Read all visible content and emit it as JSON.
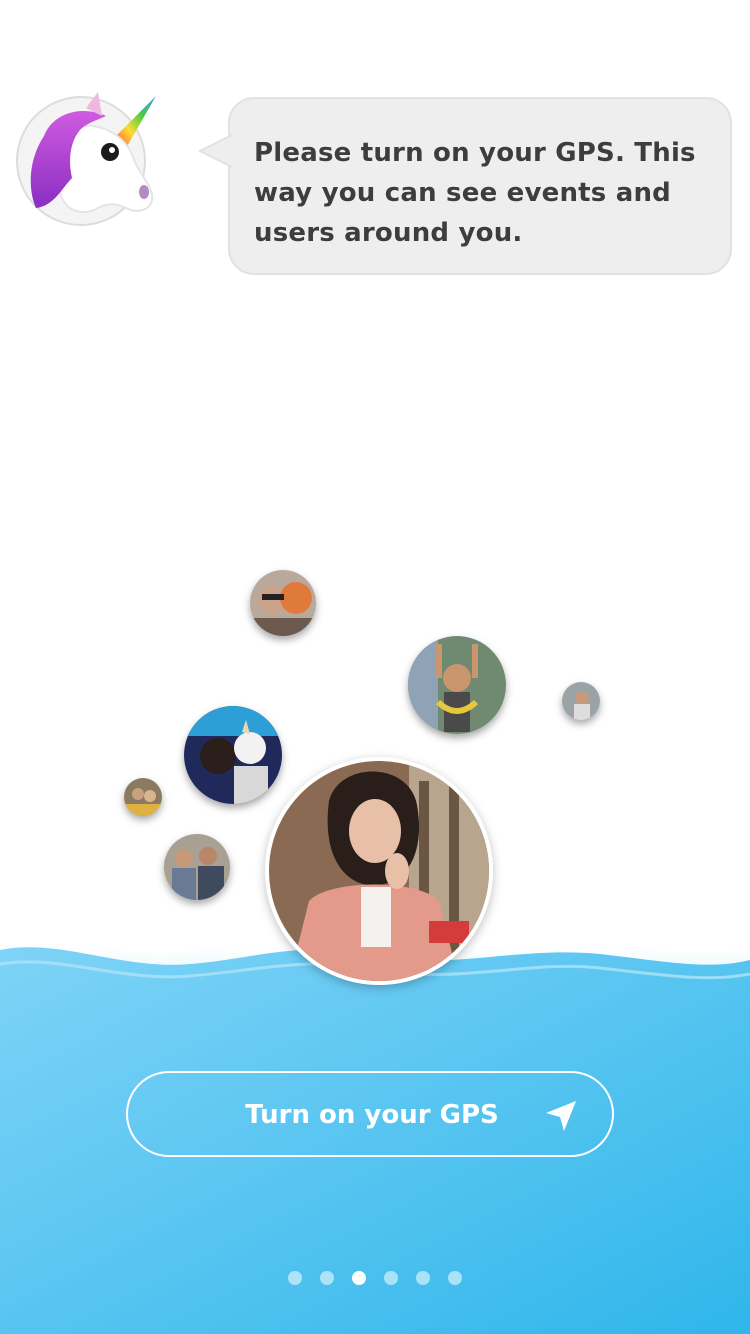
{
  "message": {
    "text": "Please turn on your GPS. This way you can see events and users around you."
  },
  "mascot": {
    "icon": "unicorn-icon"
  },
  "gps_button": {
    "label": "Turn on your GPS",
    "icon": "location-arrow-icon"
  },
  "pagination": {
    "total": 6,
    "active_index": 2
  },
  "colors": {
    "bubble_bg": "#eeeeee",
    "text": "#3d3d3d",
    "water_light": "#7fd3f7",
    "water_dark": "#2fb6ea"
  }
}
